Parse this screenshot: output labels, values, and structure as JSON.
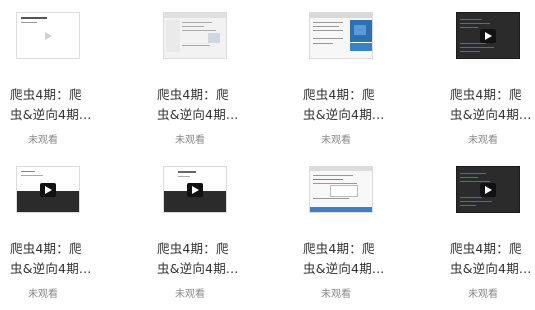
{
  "cards": [
    {
      "title_line1": "爬虫4期：爬",
      "title_line2": "虫&逆向4期...",
      "status": "未观看"
    },
    {
      "title_line1": "爬虫4期：爬",
      "title_line2": "虫&逆向4期...",
      "status": "未观看"
    },
    {
      "title_line1": "爬虫4期：爬",
      "title_line2": "虫&逆向4期...",
      "status": "未观看"
    },
    {
      "title_line1": "爬虫4期：爬",
      "title_line2": "虫&逆向4期...",
      "status": "未观看"
    },
    {
      "title_line1": "爬虫4期：爬",
      "title_line2": "虫&逆向4期...",
      "status": "未观看"
    },
    {
      "title_line1": "爬虫4期：爬",
      "title_line2": "虫&逆向4期...",
      "status": "未观看"
    },
    {
      "title_line1": "爬虫4期：爬",
      "title_line2": "虫&逆向4期...",
      "status": "未观看"
    },
    {
      "title_line1": "爬虫4期：爬",
      "title_line2": "虫&逆向4期...",
      "status": "未观看"
    }
  ],
  "icons": {
    "play": "play-icon"
  },
  "colors": {
    "title": "#333333",
    "status": "#888888",
    "dark_thumb": "#2b2b2b"
  }
}
